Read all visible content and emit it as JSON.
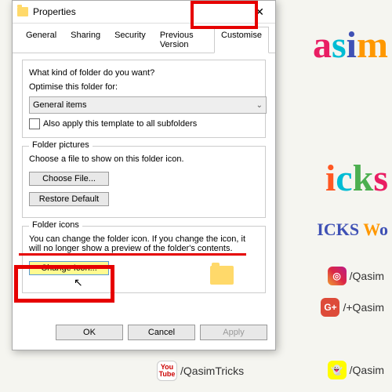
{
  "window": {
    "title": "Properties"
  },
  "tabs": {
    "general": "General",
    "sharing": "Sharing",
    "security": "Security",
    "previous": "Previous Version",
    "customise": "Customise"
  },
  "group1": {
    "q": "What kind of folder do you want?",
    "opt_label": "Optimise this folder for:",
    "select_value": "General items",
    "checkbox_label": "Also apply this template to all subfolders"
  },
  "group2": {
    "title": "Folder pictures",
    "text": "Choose a file to show on this folder icon.",
    "choose": "Choose File...",
    "restore": "Restore Default"
  },
  "group3": {
    "title": "Folder icons",
    "text": "You can change the folder icon. If you change the icon, it will no longer show a preview of the folder's contents.",
    "change": "Change Icon..."
  },
  "buttons": {
    "ok": "OK",
    "cancel": "Cancel",
    "apply": "Apply"
  },
  "social": {
    "ig": "/Qasim",
    "gp": "/+Qasim",
    "yt": "/QasimTricks",
    "sc": "/Qasim"
  },
  "decor": {
    "line1": "asim",
    "line2": "icks",
    "line3": "ICKS WO"
  }
}
